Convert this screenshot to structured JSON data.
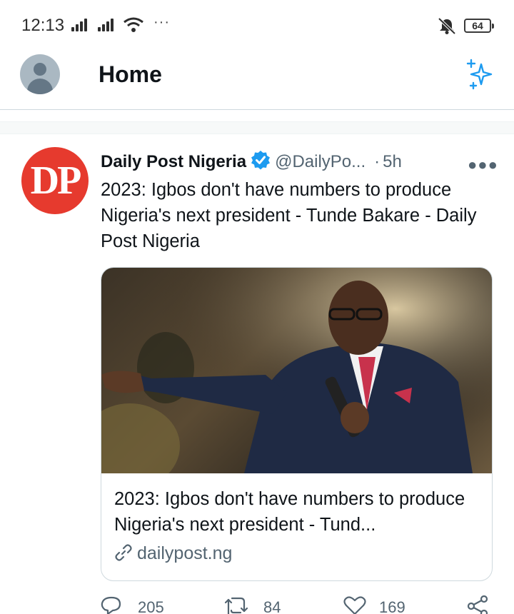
{
  "status_bar": {
    "time": "12:13",
    "dots": "···",
    "battery": "64"
  },
  "header": {
    "title": "Home"
  },
  "tweet": {
    "author_name": "Daily Post Nigeria",
    "handle": "@DailyPo...",
    "separator": "·",
    "time": "5h",
    "avatar_text": "DP",
    "text": "2023: Igbos don't have numbers to produce Nigeria's next president - Tunde Bakare - Daily Post Nigeria",
    "card": {
      "title": "2023: Igbos don't have numbers to produce Nigeria's next president - Tund...",
      "domain": "dailypost.ng"
    },
    "actions": {
      "replies": "205",
      "retweets": "84",
      "likes": "169"
    }
  },
  "colors": {
    "accent": "#1d9bf0",
    "avatar_bg": "#e63a2e",
    "secondary_text": "#536471"
  }
}
